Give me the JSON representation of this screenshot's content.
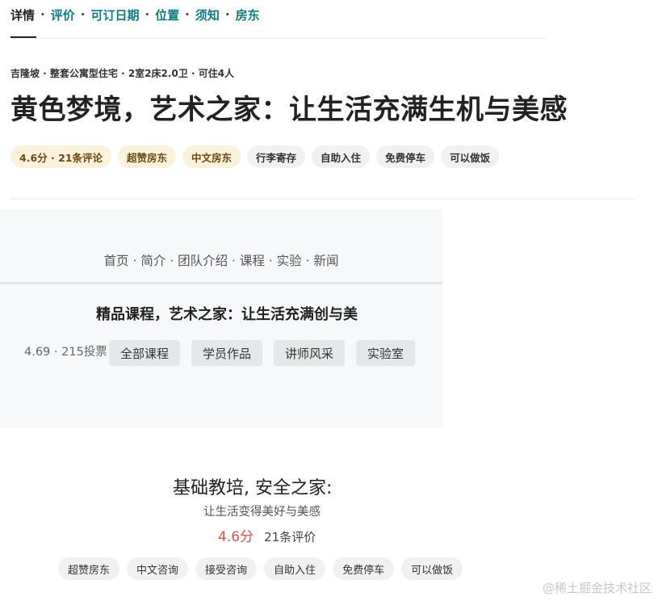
{
  "nav": {
    "tabs": [
      "详情",
      "评价",
      "可订日期",
      "位置",
      "须知",
      "房东"
    ],
    "separator": "·",
    "active_index": 0
  },
  "listing": {
    "subtitle": "吉隆坡 · 整套公寓型住宅 · 2室2床2.0卫 · 可住4人",
    "title": "黄色梦境，艺术之家：让生活充满生机与美感",
    "chips": [
      {
        "label": "4.6分 · 21条评论",
        "style": "gold"
      },
      {
        "label": "超赞房东",
        "style": "gold"
      },
      {
        "label": "中文房东",
        "style": "gold"
      },
      {
        "label": "行李寄存",
        "style": "plain"
      },
      {
        "label": "自助入住",
        "style": "plain"
      },
      {
        "label": "免费停车",
        "style": "plain"
      },
      {
        "label": "可以做饭",
        "style": "plain"
      }
    ]
  },
  "card": {
    "nav_text": "首页 · 简介 · 团队介绍 · 课程 · 实验 · 新闻",
    "title": "精品课程，艺术之家：让生活充满创与美",
    "rating": "4.69 · 215投票",
    "buttons": [
      "全部课程",
      "学员作品",
      "讲师风采",
      "实验室"
    ]
  },
  "bottom": {
    "title": "基础教培, 安全之家:",
    "subtitle": "让生活变得美好与美感",
    "score": "4.6分",
    "reviews": "21条评价",
    "chips": [
      "超赞房东",
      "中文咨询",
      "接受咨询",
      "自助入住",
      "免费停车",
      "可以做饭"
    ]
  },
  "watermark": "@稀土掘金技术社区",
  "colors": {
    "accent_teal": "#0c7c83",
    "gold_chip_bg": "#fbf2dc",
    "score_red": "#d9534f"
  }
}
